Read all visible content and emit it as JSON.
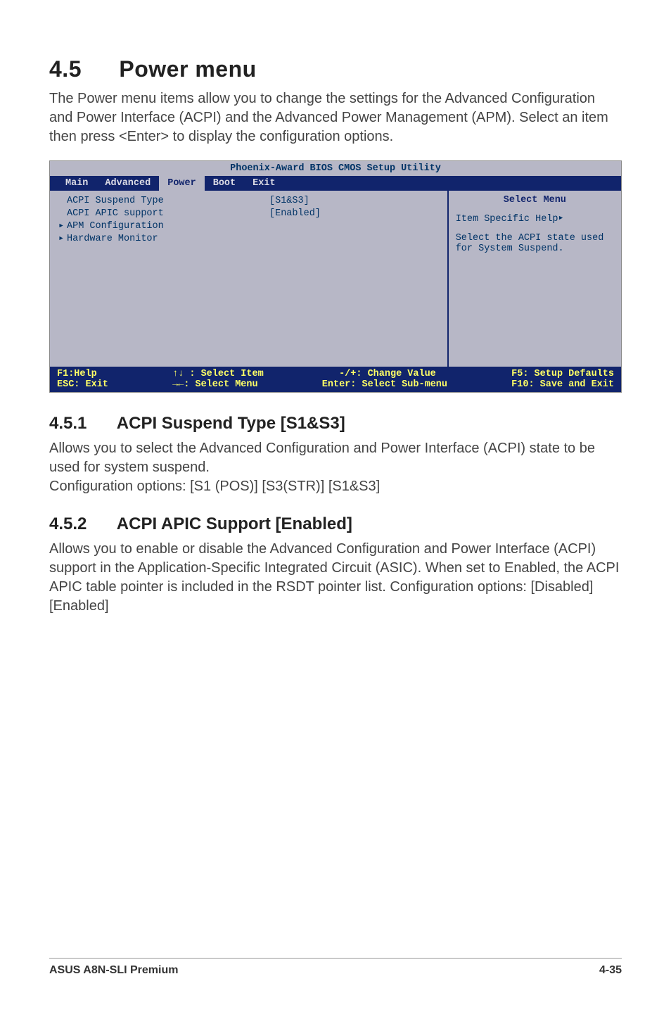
{
  "heading": {
    "num": "4.5",
    "title": "Power menu"
  },
  "intro": "The Power menu items allow you to change the settings for the Advanced Configuration and Power Interface (ACPI) and the Advanced Power Management (APM). Select an item then press <Enter> to display the configuration options.",
  "bios": {
    "header": "Phoenix-Award BIOS CMOS Setup Utility",
    "tabs": [
      "Main",
      "Advanced",
      "Power",
      "Boot",
      "Exit"
    ],
    "active_tab": "Power",
    "items": [
      {
        "label": "ACPI Suspend Type",
        "value": "[S1&S3]",
        "submenu": false
      },
      {
        "label": "ACPI APIC support",
        "value": "[Enabled]",
        "submenu": false
      },
      {
        "label": "APM Configuration",
        "value": "",
        "submenu": true
      },
      {
        "label": "Hardware Monitor",
        "value": "",
        "submenu": true
      }
    ],
    "help": {
      "title": "Select Menu",
      "line1": "Item Specific Help",
      "body": "Select the ACPI state used for System Suspend."
    },
    "footer": {
      "f1": "F1:Help",
      "esc": "ESC: Exit",
      "selitem": "↑↓ : Select Item",
      "selmenu": "→←: Select Menu",
      "change": "-/+: Change Value",
      "enter": "Enter: Select Sub-menu",
      "f5": "F5: Setup Defaults",
      "f10": "F10: Save and Exit"
    }
  },
  "sec1": {
    "num": "4.5.1",
    "title": "ACPI Suspend Type [S1&S3]",
    "body1": "Allows you to select the Advanced Configuration and Power Interface (ACPI) state to be used for system suspend.",
    "body2": "Configuration options: [S1 (POS)] [S3(STR)] [S1&S3]"
  },
  "sec2": {
    "num": "4.5.2",
    "title": "ACPI APIC Support [Enabled]",
    "body": "Allows you to enable or disable the Advanced Configuration and Power Interface (ACPI) support in the Application-Specific Integrated Circuit (ASIC). When set to Enabled, the ACPI APIC table pointer is included in the RSDT pointer list. Configuration options: [Disabled] [Enabled]"
  },
  "footer": {
    "left": "ASUS A8N-SLI Premium",
    "right": "4-35"
  }
}
